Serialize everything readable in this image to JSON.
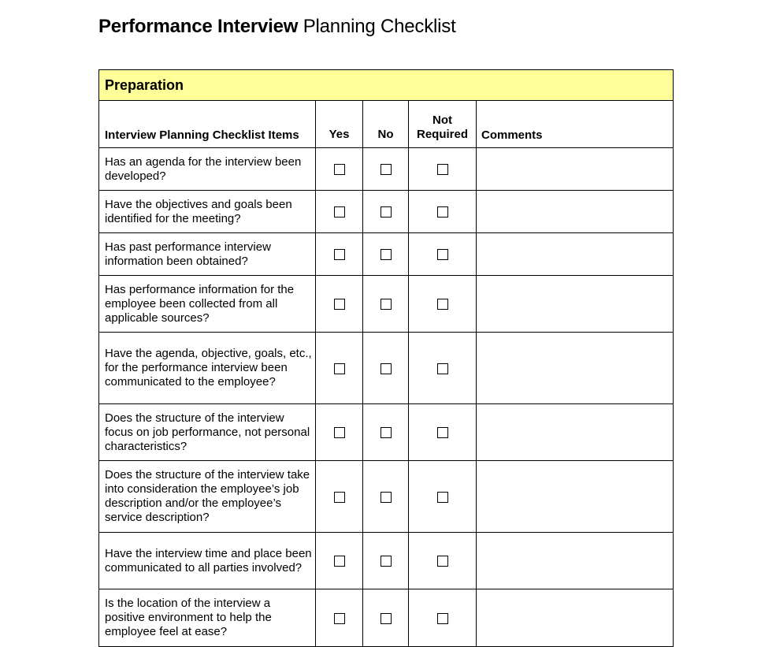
{
  "title": {
    "bold_part": "Performance Interview",
    "regular_part": "Planning Checklist"
  },
  "section": {
    "label": "Preparation",
    "highlight_color": "#ffff99"
  },
  "columns": {
    "items": "Interview Planning Checklist Items",
    "yes": "Yes",
    "no": "No",
    "not_required_line1": "Not",
    "not_required_line2": "Required",
    "comments": "Comments"
  },
  "rows": [
    {
      "question": "Has an agenda for the interview been developed?",
      "yes": false,
      "no": false,
      "not_required": false,
      "comment": ""
    },
    {
      "question": "Have the objectives and goals been identified for the meeting?",
      "yes": false,
      "no": false,
      "not_required": false,
      "comment": ""
    },
    {
      "question": "Has past performance interview information been obtained?",
      "yes": false,
      "no": false,
      "not_required": false,
      "comment": ""
    },
    {
      "question": "Has performance information for the employee been collected from all applicable sources?",
      "yes": false,
      "no": false,
      "not_required": false,
      "comment": ""
    },
    {
      "question": "Have the agenda, objective, goals, etc., for the performance interview been communicated to the employee?",
      "yes": false,
      "no": false,
      "not_required": false,
      "comment": ""
    },
    {
      "question": "Does the structure of the interview focus on job performance, not personal characteristics?",
      "yes": false,
      "no": false,
      "not_required": false,
      "comment": ""
    },
    {
      "question": "Does the structure of the interview take into consideration the employee’s job description and/or the employee’s service description?",
      "yes": false,
      "no": false,
      "not_required": false,
      "comment": ""
    },
    {
      "question": "Have the interview time and place been communicated to all parties involved?",
      "yes": false,
      "no": false,
      "not_required": false,
      "comment": ""
    },
    {
      "question": "Is the location of the interview a positive environment to help the employee feel at ease?",
      "yes": false,
      "no": false,
      "not_required": false,
      "comment": ""
    }
  ]
}
